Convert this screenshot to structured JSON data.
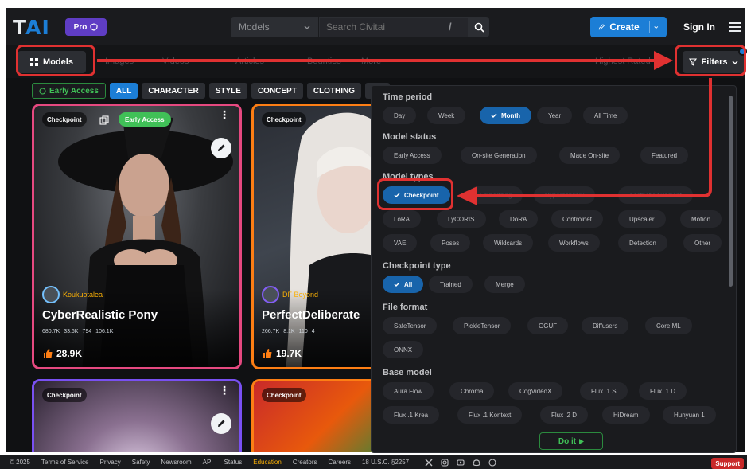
{
  "header": {
    "logo_letters": [
      "T",
      "AI"
    ],
    "pro_label": "Pro",
    "search_scope": "Models",
    "search_placeholder": "Search Civitai",
    "search_hotkey": "/",
    "create_label": "Create",
    "signin_label": "Sign In"
  },
  "subnav": {
    "models_label": "Models",
    "items": [
      "Images",
      "Videos",
      "Articles",
      "Bounties",
      "More"
    ],
    "right_item": "Highest Rated",
    "filters_label": "Filters"
  },
  "chips": [
    "Early Access",
    "ALL",
    "CHARACTER",
    "STYLE",
    "CONCEPT",
    "CLOTHING",
    "BA"
  ],
  "cards": [
    {
      "type": "Checkpoint",
      "early_access": "Early Access",
      "creator": "Koukuotalea",
      "title": "CyberRealistic Pony",
      "stats": [
        "680.7K",
        "33.6K",
        "794",
        "106.1K"
      ],
      "likes": "28.9K",
      "border": "#e64980"
    },
    {
      "type": "Checkpoint",
      "creator": "DF Beyond",
      "title": "PerfectDeliberate",
      "stats": [
        "266.7K",
        "8.1K",
        "110",
        "4"
      ],
      "likes": "19.7K",
      "border": "#fd7e14"
    },
    {
      "type": "Checkpoint",
      "border": "#7950f2"
    },
    {
      "type": "Checkpoint",
      "border": "#fd7e14"
    }
  ],
  "filters": {
    "time_period": {
      "label": "Time period",
      "options": [
        "Day",
        "Week",
        "Month",
        "Year",
        "All Time"
      ],
      "selected": "Month"
    },
    "model_status": {
      "label": "Model status",
      "options": [
        "Early Access",
        "On-site Generation",
        "Made On-site",
        "Featured"
      ]
    },
    "model_types": {
      "label": "Model types",
      "row1": [
        "Checkpoint",
        "Embedding",
        "Hypernetwork",
        "Aesthetic Gradient"
      ],
      "row2": [
        "LoRA",
        "LyCORIS",
        "DoRA",
        "Controlnet",
        "Upscaler",
        "Motion"
      ],
      "row3": [
        "VAE",
        "Poses",
        "Wildcards",
        "Workflows",
        "Detection",
        "Other"
      ],
      "selected": "Checkpoint"
    },
    "checkpoint_type": {
      "label": "Checkpoint type",
      "options": [
        "All",
        "Trained",
        "Merge"
      ],
      "selected": "All"
    },
    "file_format": {
      "label": "File format",
      "row1": [
        "SafeTensor",
        "PickleTensor",
        "GGUF",
        "Diffusers",
        "Core ML"
      ],
      "row2": [
        "ONNX"
      ]
    },
    "base_model": {
      "label": "Base model",
      "row1": [
        "Aura Flow",
        "Chroma",
        "CogVideoX",
        "Flux .1 S",
        "Flux .1 D"
      ],
      "row2": [
        "Flux .1 Krea",
        "Flux .1 Kontext",
        "Flux .2 D",
        "HiDream",
        "Hunyuan 1"
      ]
    },
    "apply_label": "Do it"
  },
  "footer": {
    "links": [
      "© 2025",
      "Terms of Service",
      "Privacy",
      "Safety",
      "Newsroom",
      "API",
      "Status",
      "Education",
      "Creators",
      "Careers",
      "18 U.S.C. §2257"
    ],
    "support_label": "Support"
  },
  "colors": {
    "accent": "#1c7ed6",
    "annotation": "#e03131",
    "success": "#40c057"
  },
  "icons": [
    "shield-icon",
    "chevron-down-icon",
    "search-icon",
    "pencil-icon",
    "menu-icon",
    "grid-icon",
    "filter-icon",
    "check-icon",
    "heart-icon",
    "edit-icon",
    "kebab-icon",
    "x-icon",
    "instagram-icon",
    "youtube-icon",
    "discord-icon",
    "github-icon"
  ]
}
